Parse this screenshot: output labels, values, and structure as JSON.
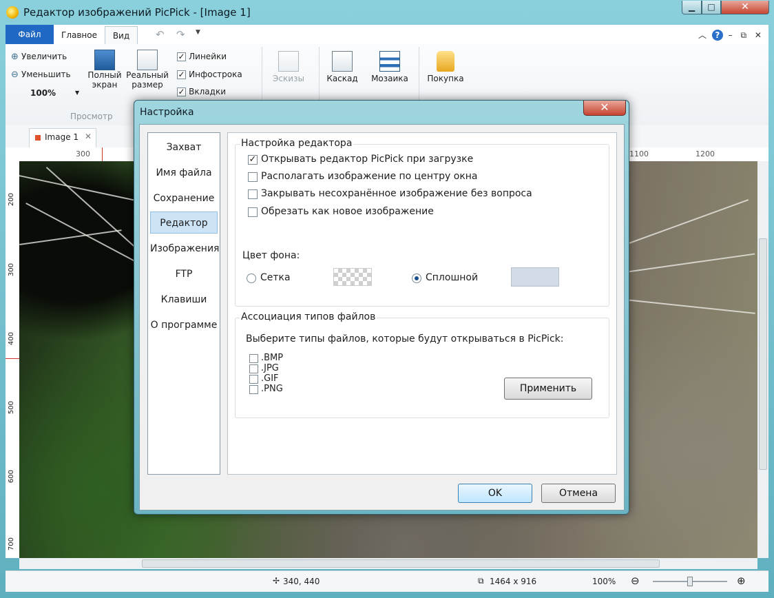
{
  "window": {
    "title": "Редактор изображений PicPick - [Image 1]"
  },
  "ribbon": {
    "tabs": {
      "file": "Файл",
      "home": "Главное",
      "view": "Вид"
    },
    "zoom_in": "Увеличить",
    "zoom_out": "Уменьшить",
    "zoom_value": "100%",
    "fullscreen": {
      "line1": "Полный",
      "line2": "экран"
    },
    "actual_size": {
      "line1": "Реальный",
      "line2": "размер"
    },
    "checks": [
      {
        "label": "Линейки",
        "checked": true
      },
      {
        "label": "Инфострока",
        "checked": true
      },
      {
        "label": "Вкладки",
        "checked": true
      }
    ],
    "group_preview": "Просмотр",
    "thumbnails": "Эскизы",
    "cascade": "Каскад",
    "mosaic": "Мозаика",
    "purchase": "Покупка"
  },
  "doc_tab": {
    "label": "Image 1"
  },
  "ruler_h": {
    "ticks": [
      "300",
      "1100",
      "1200"
    ]
  },
  "ruler_v": {
    "ticks": [
      "200",
      "300",
      "400",
      "500",
      "600",
      "700"
    ]
  },
  "status": {
    "cursor": "340, 440",
    "size": "1464 x 916",
    "zoom": "100%"
  },
  "dialog": {
    "title": "Настройка",
    "nav": [
      "Захват",
      "Имя файла",
      "Сохранение",
      "Редактор",
      "Изображения",
      "FTP",
      "Клавиши",
      "О программе"
    ],
    "selected_nav": "Редактор",
    "editor_group": {
      "title": "Настройка редактора",
      "options": [
        {
          "label": "Открывать редактор PicPick при загрузке",
          "checked": true
        },
        {
          "label": "Располагать изображение по центру окна",
          "checked": false
        },
        {
          "label": "Закрывать несохранённое изображение без вопроса",
          "checked": false
        },
        {
          "label": "Обрезать как новое изображение",
          "checked": false
        }
      ],
      "bg_label": "Цвет фона:",
      "bg_grid": "Сетка",
      "bg_solid": "Сплошной",
      "bg_selected": "Сплошной",
      "bg_solid_color": "#d3dbe8"
    },
    "assoc_group": {
      "title": "Ассоциация типов файлов",
      "prompt": "Выберите типы файлов, которые будут открываться в PicPick:",
      "types": [
        ".BMP",
        ".JPG",
        ".GIF",
        ".PNG"
      ],
      "apply": "Применить"
    },
    "ok": "OK",
    "cancel": "Отмена"
  },
  "colors": {
    "file_tab": "#1f68c4",
    "frame": "#6fb7c4",
    "close_button": "#c64532",
    "selection": "#cde4f7"
  }
}
